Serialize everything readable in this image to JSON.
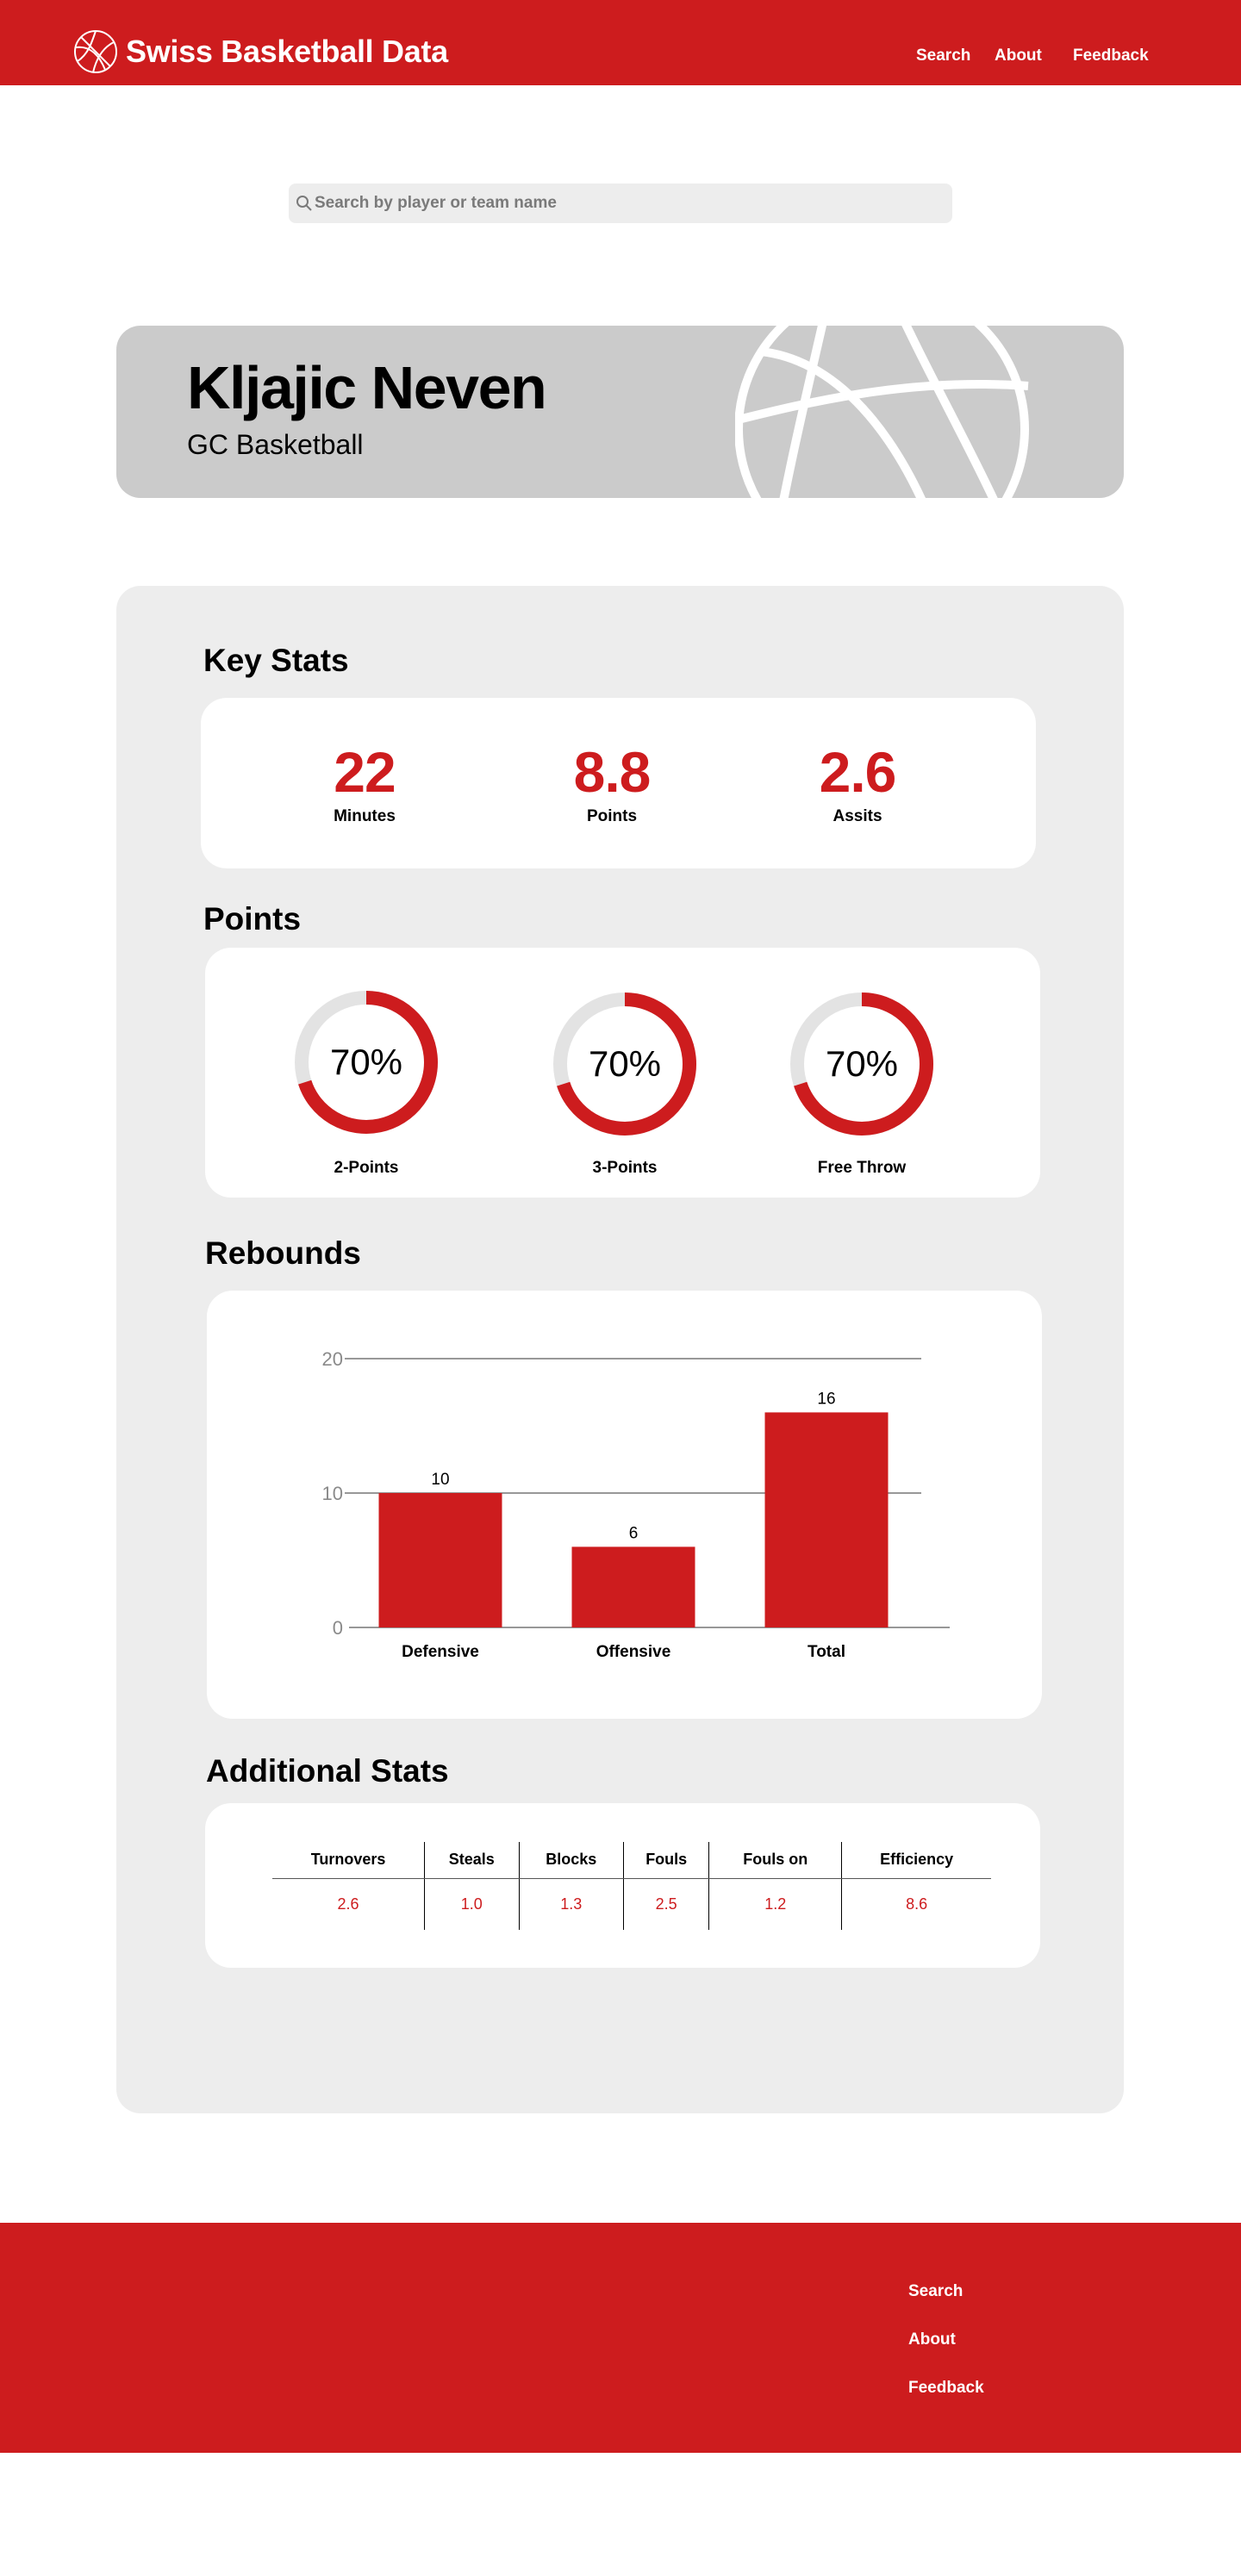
{
  "header": {
    "site_title": "Swiss Basketball Data",
    "logo_icon": "basketball-icon",
    "nav": [
      "Search",
      "About",
      "Feedback"
    ]
  },
  "search": {
    "placeholder": "Search by player or team name",
    "value": "",
    "icon": "search-icon"
  },
  "player": {
    "name": "Kljajic Neven",
    "team": "GC Basketball"
  },
  "key_stats": {
    "title": "Key Stats",
    "items": [
      {
        "value": "22",
        "label": "Minutes"
      },
      {
        "value": "8.8",
        "label": "Points"
      },
      {
        "value": "2.6",
        "label": "Assits"
      }
    ]
  },
  "points": {
    "title": "Points",
    "items": [
      {
        "percent": 70,
        "display": "70%",
        "label": "2-Points"
      },
      {
        "percent": 70,
        "display": "70%",
        "label": "3-Points"
      },
      {
        "percent": 70,
        "display": "70%",
        "label": "Free Throw"
      }
    ]
  },
  "rebounds": {
    "title": "Rebounds"
  },
  "chart_data": {
    "type": "bar",
    "categories": [
      "Defensive",
      "Offensive",
      "Total"
    ],
    "values": [
      10,
      6,
      16
    ],
    "data_labels": [
      "10",
      "6",
      "16"
    ],
    "y_ticks": [
      "0",
      "10",
      "20"
    ],
    "ylim": [
      0,
      20
    ],
    "grid": true,
    "xlabel": "",
    "ylabel": "",
    "bar_color": "#CD1C1E"
  },
  "additional_stats": {
    "title": "Additional Stats",
    "headers": [
      "Turnovers",
      "Steals",
      "Blocks",
      "Fouls",
      "Fouls on",
      "Efficiency"
    ],
    "values": [
      "2.6",
      "1.0",
      "1.3",
      "2.5",
      "1.2",
      "8.6"
    ]
  },
  "footer": {
    "links": [
      "Search",
      "About",
      "Feedback"
    ]
  },
  "colors": {
    "accent": "#CD1C1E",
    "panel": "#EDEDED",
    "banner": "#CBCBCB"
  }
}
